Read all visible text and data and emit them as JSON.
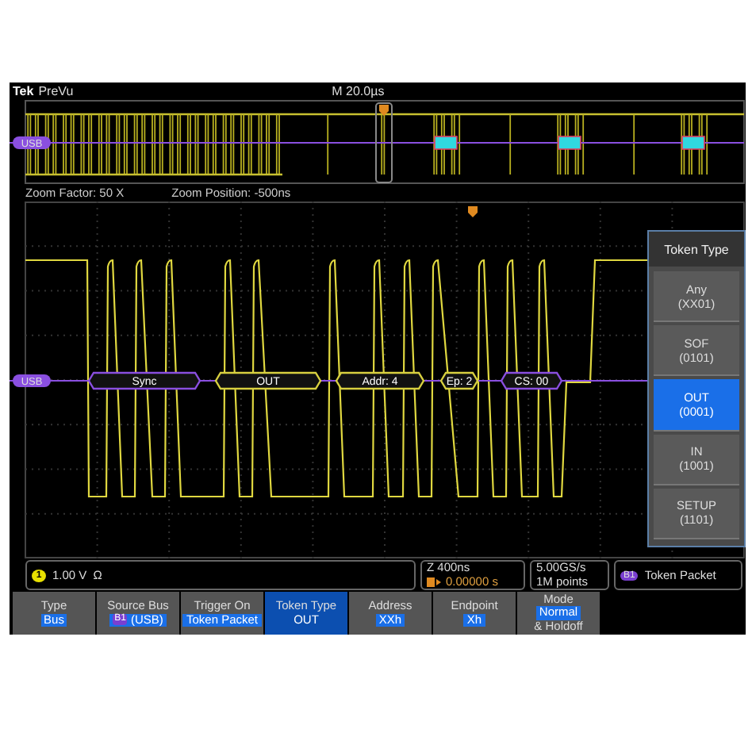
{
  "header": {
    "brand": "Tek",
    "mode": "PreVu",
    "timebase": "M 20.0µs"
  },
  "overview": {
    "bus_label": "USB"
  },
  "zoom": {
    "factor": "Zoom Factor: 50 X",
    "position": "Zoom Position: -500ns"
  },
  "main": {
    "bus_label": "USB",
    "packets": [
      {
        "label": "Sync",
        "color": "#8a4fe0"
      },
      {
        "label": "OUT",
        "color": "#d8d040"
      },
      {
        "label": "Addr: 4",
        "color": "#d8d040"
      },
      {
        "label": "Ep: 2",
        "color": "#d8d040"
      },
      {
        "label": "CS: 00",
        "color": "#8a4fe0"
      }
    ]
  },
  "side_menu": {
    "title": "Token Type",
    "options": [
      {
        "label": "Any",
        "code": "(XX01)",
        "selected": false
      },
      {
        "label": "SOF",
        "code": "(0101)",
        "selected": false
      },
      {
        "label": "OUT",
        "code": "(0001)",
        "selected": true
      },
      {
        "label": "IN",
        "code": "(1001)",
        "selected": false
      },
      {
        "label": "SETUP",
        "code": "(1101)",
        "selected": false
      }
    ]
  },
  "status": {
    "channel": "1",
    "scale": "1.00 V",
    "coupling": "Ω",
    "zoom_time": "Z 400ns",
    "trigger_position": "0.00000 s",
    "sample_rate": "5.00GS/s",
    "record_length": "1M points",
    "bus": "B1",
    "trigger_type": "Token Packet"
  },
  "soft_keys": [
    {
      "label": "Type",
      "value": "Bus",
      "selected": false
    },
    {
      "label": "Source Bus",
      "badge": "B1",
      "value": "(USB)",
      "selected": false
    },
    {
      "label": "Trigger On",
      "value": "Token Packet",
      "selected": false
    },
    {
      "label": "Token Type",
      "value": "OUT",
      "selected": true
    },
    {
      "label": "Address",
      "value": "XXh",
      "selected": false
    },
    {
      "label": "Endpoint",
      "value": "Xh",
      "selected": false
    },
    {
      "label": "Mode",
      "value": "Normal",
      "extra": "& Holdoff",
      "selected": false
    }
  ]
}
